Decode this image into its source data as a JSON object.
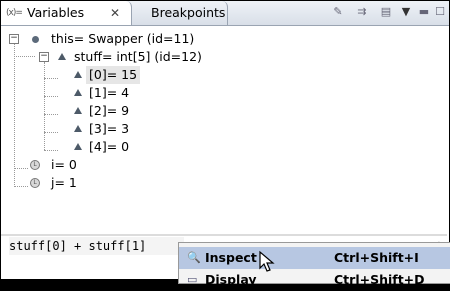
{
  "tabs": {
    "active": {
      "icon": "(x)=",
      "label": "Variables",
      "close": "✕"
    },
    "inactive": {
      "label": "Breakpoints"
    }
  },
  "toolbar": [
    "show-type-names-icon",
    "collapse-all-icon",
    "toggle-detail-icon",
    "view-menu-icon",
    "minimize-icon",
    "maximize-icon"
  ],
  "tree": {
    "root": {
      "label": "this= Swapper (id=11)"
    },
    "stuff": {
      "label": "stuff= int[5]  (id=12)"
    },
    "elements": [
      "[0]= 15",
      "[1]= 4",
      "[2]= 9",
      "[3]= 3",
      "[4]= 0"
    ],
    "locals": [
      "i= 0",
      "j= 1"
    ]
  },
  "detail": {
    "text": "stuff[0] + stuff[1]"
  },
  "menu": {
    "items": [
      {
        "label": "Inspect",
        "shortcut": "Ctrl+Shift+I"
      },
      {
        "label": "Display",
        "shortcut": "Ctrl+Shift+D"
      }
    ]
  },
  "colors": {
    "selection_row": "#e6e6e6",
    "menu_hover": "#b7c7e2",
    "tab_bar": "#dde3ec"
  }
}
